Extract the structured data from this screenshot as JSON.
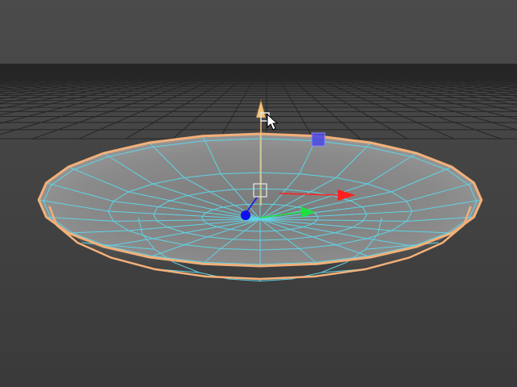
{
  "viewport": {
    "background_top": "#4b4b4b",
    "background_bottom": "#3a3a3a",
    "grid_color": "#262626",
    "grid_axis_color": "#1a1a1a"
  },
  "mesh": {
    "object": "dish",
    "wireframe_color": "#5fd4e6",
    "selection_outline_color": "#f3b07a",
    "rim_segments": 24
  },
  "manipulator": {
    "x_axis_color": "#ff2020",
    "y_axis_color": "#20e040",
    "z_axis_color": "#1010ee",
    "up_handle_color": "#f5c27a",
    "vertex_handle_color": "#4a46e6",
    "handle_box_color": "#e8e8e8"
  },
  "cursor": {
    "icon": "arrow-cursor-icon"
  }
}
